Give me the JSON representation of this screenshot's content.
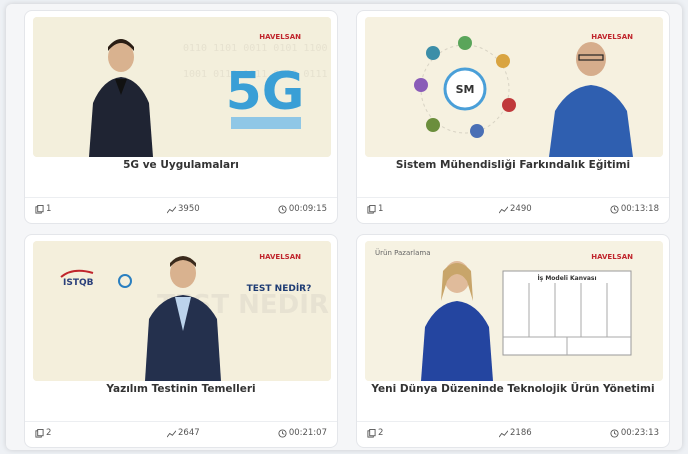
{
  "cards": [
    {
      "title": "5G ve Uygulamaları",
      "parts": "1",
      "views": "3950",
      "duration": "00:09:15",
      "thumb_text": "5G",
      "brand": "HAVELSAN"
    },
    {
      "title": "Sistem Mühendisliği Farkındalık Eğitimi",
      "parts": "1",
      "views": "2490",
      "duration": "00:13:18",
      "thumb_text": "SM",
      "brand": "HAVELSAN"
    },
    {
      "title": "Yazılım Testinin Temelleri",
      "parts": "2",
      "views": "2647",
      "duration": "00:21:07",
      "thumb_text": "TEST NEDİR?",
      "brand": "HAVELSAN",
      "logo": "ISTQB"
    },
    {
      "title": "Yeni Dünya Düzeninde Teknolojik Ürün Yönetimi",
      "parts": "2",
      "views": "2186",
      "duration": "00:23:13",
      "thumb_text": "İş Modeli Kanvası",
      "caption": "Ürün Pazarlama",
      "brand": "HAVELSAN"
    }
  ],
  "icons": {
    "parts": "copy-icon",
    "views": "chart-icon",
    "duration": "clock-icon"
  }
}
